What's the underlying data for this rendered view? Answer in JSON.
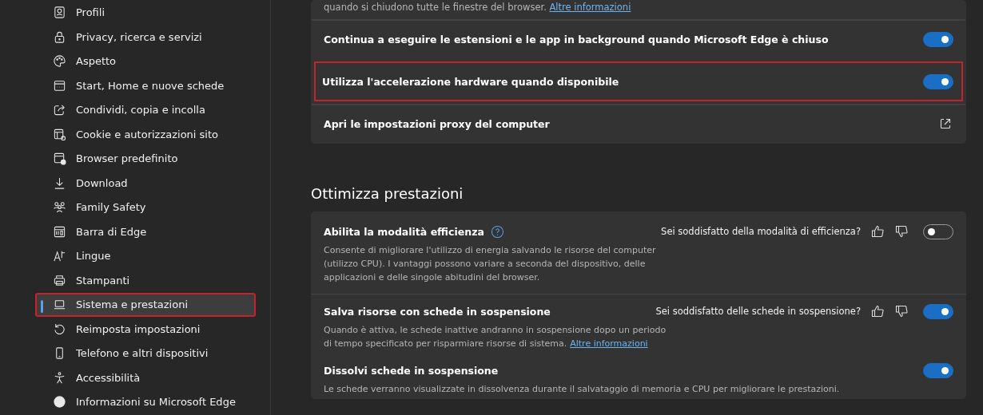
{
  "sidebar": {
    "items": [
      {
        "label": "Profili",
        "selected": false,
        "highlighted": false
      },
      {
        "label": "Privacy, ricerca e servizi",
        "selected": false,
        "highlighted": false
      },
      {
        "label": "Aspetto",
        "selected": false,
        "highlighted": false
      },
      {
        "label": "Start, Home e nuove schede",
        "selected": false,
        "highlighted": false
      },
      {
        "label": "Condividi, copia e incolla",
        "selected": false,
        "highlighted": false
      },
      {
        "label": "Cookie e autorizzazioni sito",
        "selected": false,
        "highlighted": false
      },
      {
        "label": "Browser predefinito",
        "selected": false,
        "highlighted": false
      },
      {
        "label": "Download",
        "selected": false,
        "highlighted": false
      },
      {
        "label": "Family Safety",
        "selected": false,
        "highlighted": false
      },
      {
        "label": "Barra di Edge",
        "selected": false,
        "highlighted": false
      },
      {
        "label": "Lingue",
        "selected": false,
        "highlighted": false
      },
      {
        "label": "Stampanti",
        "selected": false,
        "highlighted": false
      },
      {
        "label": "Sistema e prestazioni",
        "selected": true,
        "highlighted": true
      },
      {
        "label": "Reimposta impostazioni",
        "selected": false,
        "highlighted": false
      },
      {
        "label": "Telefono e altri dispositivi",
        "selected": false,
        "highlighted": false
      },
      {
        "label": "Accessibilità",
        "selected": false,
        "highlighted": false
      },
      {
        "label": "Informazioni su Microsoft Edge",
        "selected": false,
        "highlighted": false
      }
    ]
  },
  "system_card": {
    "intro": {
      "text": "quando si chiudono tutte le finestre del browser.",
      "link": "Altre informazioni"
    },
    "rows": [
      {
        "kind": "toggle",
        "label": "Continua a eseguire le estensioni e le app in background quando Microsoft Edge è chiuso",
        "on": true,
        "highlighted": false
      },
      {
        "kind": "toggle",
        "label": "Utilizza l'accelerazione hardware quando disponibile",
        "on": true,
        "highlighted": true
      },
      {
        "kind": "external",
        "label": "Apri le impostazioni proxy del computer",
        "highlighted": false
      }
    ]
  },
  "performance": {
    "heading": "Ottimizza prestazioni",
    "rows": [
      {
        "label": "Abilita la modalità efficienza",
        "help": true,
        "feedback": "Sei soddisfatto della modalità di efficienza?",
        "on": false,
        "description": "Consente di migliorare l'utilizzo di energia salvando le risorse del computer (utilizzo CPU). I vantaggi possono variare a seconda del dispositivo, delle applicazioni e delle singole abitudini del browser.",
        "link": ""
      },
      {
        "label": "Salva risorse con schede in sospensione",
        "help": false,
        "feedback": "Sei soddisfatto delle schede in sospensione?",
        "on": true,
        "description": "Quando è attiva, le schede inattive andranno in sospensione dopo un periodo di tempo specificato per risparmiare risorse di sistema.",
        "link": "Altre informazioni"
      },
      {
        "label": "Dissolvi schede in sospensione",
        "help": false,
        "feedback": "",
        "on": true,
        "description": "Le schede verranno visualizzate in dissolvenza durante il salvataggio di memoria e CPU per migliorare le prestazioni.",
        "link": ""
      }
    ]
  }
}
